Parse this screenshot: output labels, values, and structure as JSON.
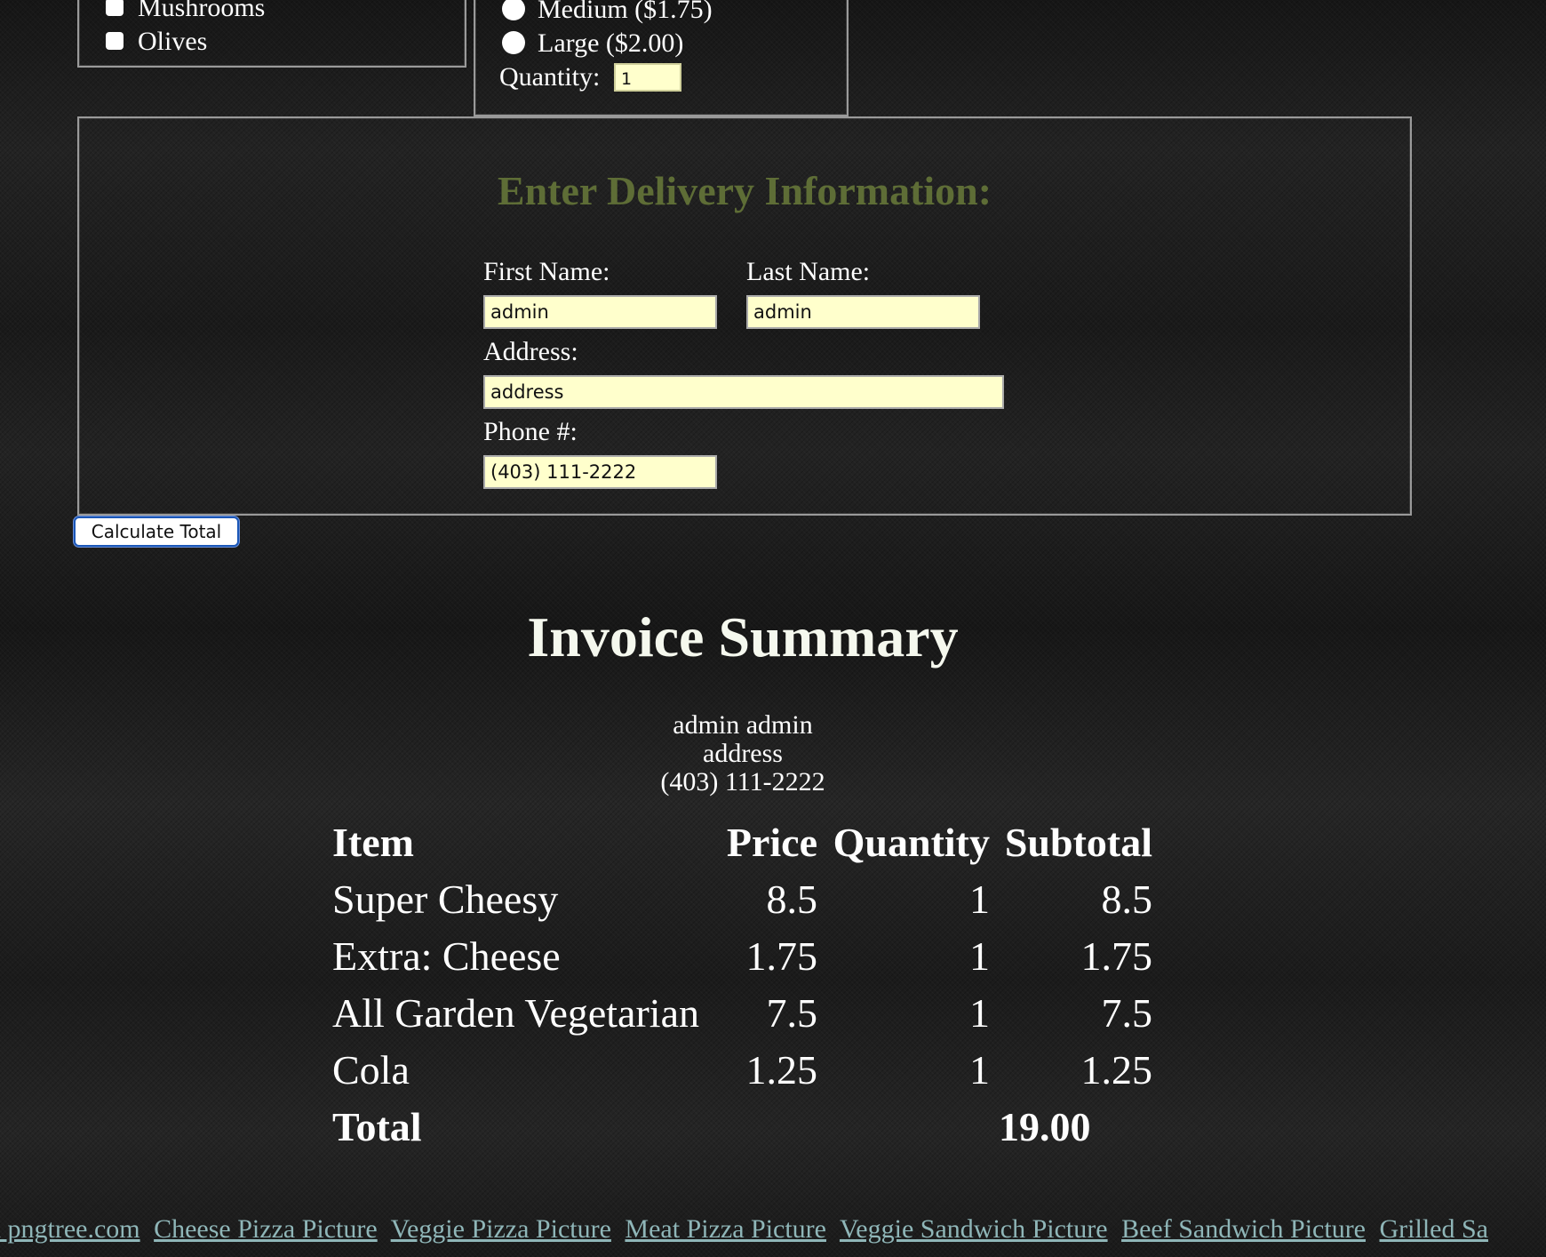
{
  "toppings": {
    "items": [
      {
        "label": "Mushrooms"
      },
      {
        "label": "Olives"
      }
    ]
  },
  "size": {
    "options": [
      {
        "label": "Medium ($1.75)"
      },
      {
        "label": "Large ($2.00)"
      }
    ],
    "quantity_label": "Quantity:",
    "quantity_value": "1"
  },
  "delivery": {
    "title": "Enter Delivery Information:",
    "first_name_label": "First Name:",
    "first_name_value": "admin",
    "last_name_label": "Last Name:",
    "last_name_value": "admin",
    "address_label": "Address:",
    "address_value": "address",
    "phone_label": "Phone #:",
    "phone_value": "(403) 111-2222"
  },
  "calculate_button": "Calculate Total",
  "invoice": {
    "title": "Invoice Summary",
    "customer_name": "admin admin",
    "customer_address": "address",
    "customer_phone": "(403) 111-2222",
    "headers": {
      "item": "Item",
      "price": "Price",
      "quantity": "Quantity",
      "subtotal": "Subtotal"
    },
    "rows": [
      {
        "item": "Super Cheesy",
        "price": "8.5",
        "quantity": "1",
        "subtotal": "8.5"
      },
      {
        "item": "Extra: Cheese",
        "price": "1.75",
        "quantity": "1",
        "subtotal": "1.75"
      },
      {
        "item": "All Garden Vegetarian",
        "price": "7.5",
        "quantity": "1",
        "subtotal": "7.5"
      },
      {
        "item": "Cola",
        "price": "1.25",
        "quantity": "1",
        "subtotal": "1.25"
      }
    ],
    "total_label": "Total",
    "total_value": "19.00"
  },
  "footer": {
    "links": [
      "n pngtree.com",
      "Cheese Pizza Picture",
      "Veggie Pizza Picture",
      "Meat Pizza Picture",
      "Veggie Sandwich Picture",
      "Beef Sandwich Picture",
      "Grilled Sa"
    ]
  },
  "colors": {
    "input_bg": "#ffffcc",
    "delivery_title": "#5e6d36",
    "link": "#8fb6b8",
    "button_border": "#1b57b8"
  }
}
